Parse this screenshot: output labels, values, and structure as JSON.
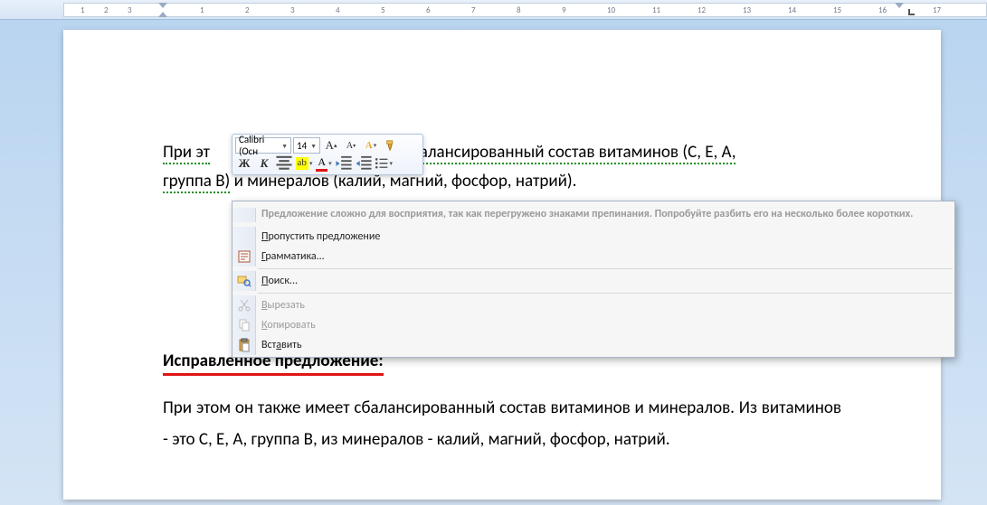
{
  "ruler": {
    "numbers": [
      "",
      "1",
      "2",
      "3",
      "",
      "1",
      "2",
      "3",
      "4",
      "5",
      "6",
      "7",
      "8",
      "9",
      "10",
      "11",
      "12",
      "13",
      "14",
      "15",
      "16",
      "",
      "17"
    ]
  },
  "miniToolbar": {
    "font": "Calibri (Осн",
    "size": "14"
  },
  "document": {
    "para1_a": "При эт",
    "para1_b": " сбалансированный состав витаминов (С, Е, А,",
    "para1_c": "группа В)",
    "para1_d": "и",
    "para1_e": "минералов",
    "para1_f": "(калий, магний, фосфор, натрий).",
    "heading": "Исправленное предложение:",
    "para2": "При этом он также имеет сбалансированный состав витаминов и минералов. Из витаминов - это С, Е, А, группа В, из минералов - калий, магний, фосфор, натрий."
  },
  "contextMenu": {
    "suggestion": "Предложение сложно для восприятия, так как перегружено знаками препинания. Попробуйте разбить его на несколько более коротких.",
    "skip": "Пропустить предложение",
    "grammar": "Грамматика...",
    "search": "Поиск...",
    "cut": "Вырезать",
    "copy": "Копировать",
    "paste": "Вставить"
  }
}
